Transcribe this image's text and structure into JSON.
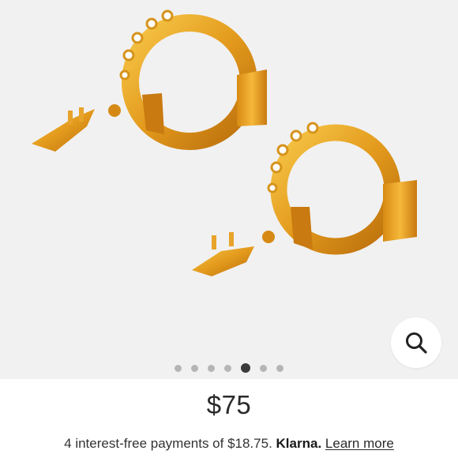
{
  "gallery": {
    "image_label": "product-photo",
    "slide_count": 7,
    "active_slide": 5,
    "zoom_icon": "search-icon"
  },
  "product": {
    "price": "$75"
  },
  "payment": {
    "text": "4 interest-free payments of $18.75.",
    "provider": "Klarna.",
    "link_label": "Learn more"
  },
  "colors": {
    "gallery_background": "#f1f1f1",
    "gold": "#e2a12a",
    "active_dot": "#3a3a3a",
    "inactive_dot": "#b5b5b5"
  }
}
